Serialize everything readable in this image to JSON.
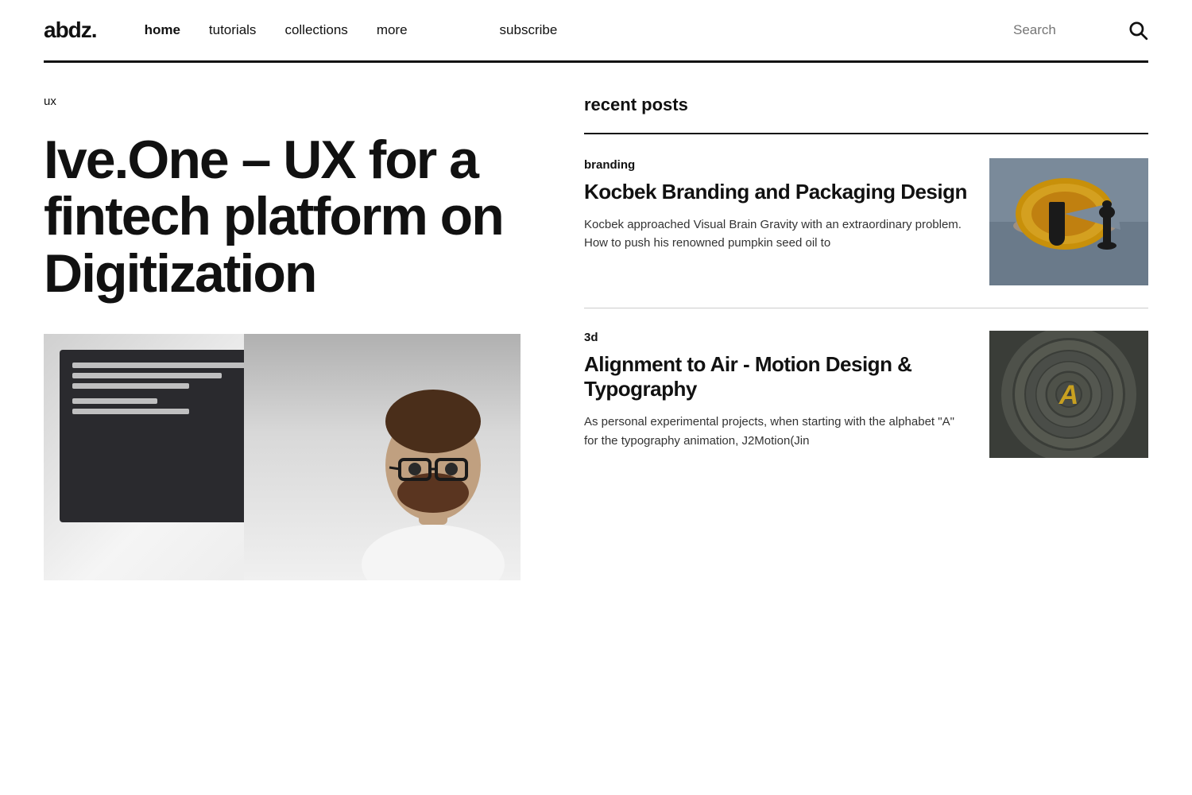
{
  "header": {
    "logo": "abdz.",
    "nav": {
      "home": "home",
      "tutorials": "tutorials",
      "collections": "collections",
      "more": "more",
      "subscribe": "subscribe"
    },
    "search": {
      "placeholder": "Search"
    }
  },
  "main": {
    "left": {
      "section_tag": "ux",
      "title": "Ive.One – UX for a fintech platform on Digitization"
    },
    "right": {
      "section_title": "recent posts",
      "posts": [
        {
          "category": "branding",
          "title": "Kocbek Branding and Packaging Design",
          "excerpt": "Kocbek approached Visual Brain Gravity with an extraordinary problem. How to push his renowned pumpkin seed oil to"
        },
        {
          "category": "3d",
          "title": "Alignment to Air - Motion Design & Typography",
          "excerpt": "As personal experimental projects, when starting with the alphabet \"A\" for the typography animation, J2Motion(Jin"
        }
      ]
    }
  }
}
